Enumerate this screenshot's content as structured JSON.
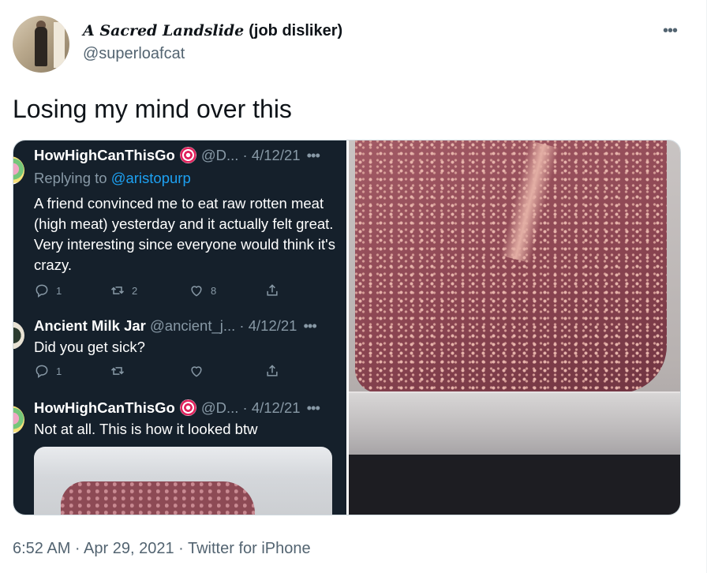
{
  "author": {
    "display_name": "A Sacred Landslide",
    "display_suffix": "(job disliker)",
    "handle": "@superloafcat"
  },
  "more_glyph": "•••",
  "tweet_text": "Losing my mind over this",
  "embedded_screenshot": {
    "reply1": {
      "name": "HowHighCanThisGo",
      "handle_date": "@D... · 4/12/21",
      "replying_prefix": "Replying to",
      "replying_handle": "@aristopurp",
      "body": "A friend convinced me to eat raw rotten meat (high meat) yesterday and it actually felt great. Very interesting since everyone would think it's crazy.",
      "reply_count": "1",
      "retweet_count": "2",
      "like_count": "8"
    },
    "reply2": {
      "name": "Ancient Milk Jar",
      "handle_date": "@ancient_j... · 4/12/21",
      "body": "Did you get sick?",
      "reply_count": "1",
      "retweet_count": "",
      "like_count": ""
    },
    "reply3": {
      "name": "HowHighCanThisGo",
      "handle_date": "@D... · 4/12/21",
      "body": "Not at all. This is how it looked btw"
    },
    "dots": "•••"
  },
  "footer": {
    "timestamp": "6:52 AM · Apr 29, 2021 · Twitter for iPhone"
  },
  "colors": {
    "dark_bg": "#15202b",
    "muted": "#8899a6",
    "link": "#1da1f2",
    "secondary_text": "#536471"
  }
}
